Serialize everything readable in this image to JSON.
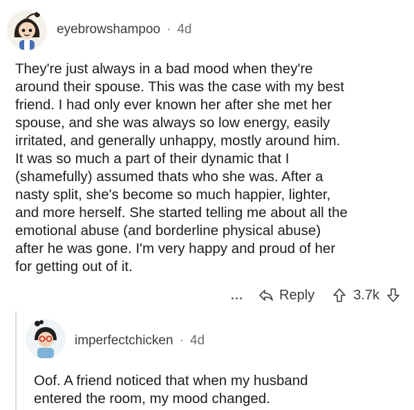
{
  "comments": [
    {
      "username": "eyebrowshampoo",
      "separator": "·",
      "age": "4d",
      "body": "They're just always in a bad mood when they're\naround their spouse.  This was the case with my best\nfriend. I had only ever known her after she met her\nspouse, and she was always so low energy, easily\nirritated, and generally unhappy, mostly around him.\nIt was so much a part of their dynamic that I\n(shamefully) assumed thats who she was. After a\nnasty split, she's become so much happier, lighter,\nand more herself. She started telling me about all the\nemotional abuse (and borderline physical abuse)\nafter he was gone. I'm very happy and proud of her\nfor getting out of it.",
      "more_label": "...",
      "reply_label": "Reply",
      "score": "3.7k"
    },
    {
      "username": "imperfectchicken",
      "separator": "·",
      "age": "4d",
      "body": "Oof. A friend noticed that when my husband\nentered the room, my mood changed."
    }
  ],
  "icons": {
    "reply": "reply-arrow-icon",
    "upvote": "upvote-arrow-icon",
    "downvote": "downvote-arrow-icon",
    "more": "more-dots-icon"
  },
  "colors": {
    "text": "#1c1c1c",
    "meta": "#3c3c3c",
    "thread_line": "#dadada"
  }
}
